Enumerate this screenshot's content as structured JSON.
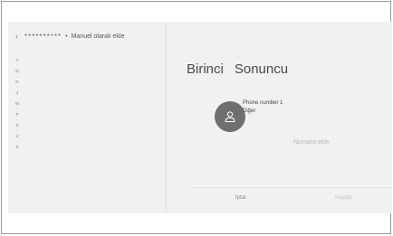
{
  "header": {
    "back_icon": "chevron-left-icon",
    "masked_name": "**********",
    "separator": "•",
    "title": "Manuel olarak ekle"
  },
  "alpha_index": [
    "A",
    "·",
    "D",
    "·",
    "G",
    "·",
    "J",
    "·",
    "M",
    "·",
    "P",
    "·",
    "S",
    "·",
    "V",
    "·",
    "Z"
  ],
  "contact": {
    "first_name": "Birinci",
    "last_name": "Sonuncu",
    "avatar_icon": "person-icon",
    "phone_label": "Phone number 1",
    "phone_type": "Diğer",
    "add_number": "Numara ekle"
  },
  "actions": {
    "cancel": "İptal",
    "save": "Kaydet"
  }
}
